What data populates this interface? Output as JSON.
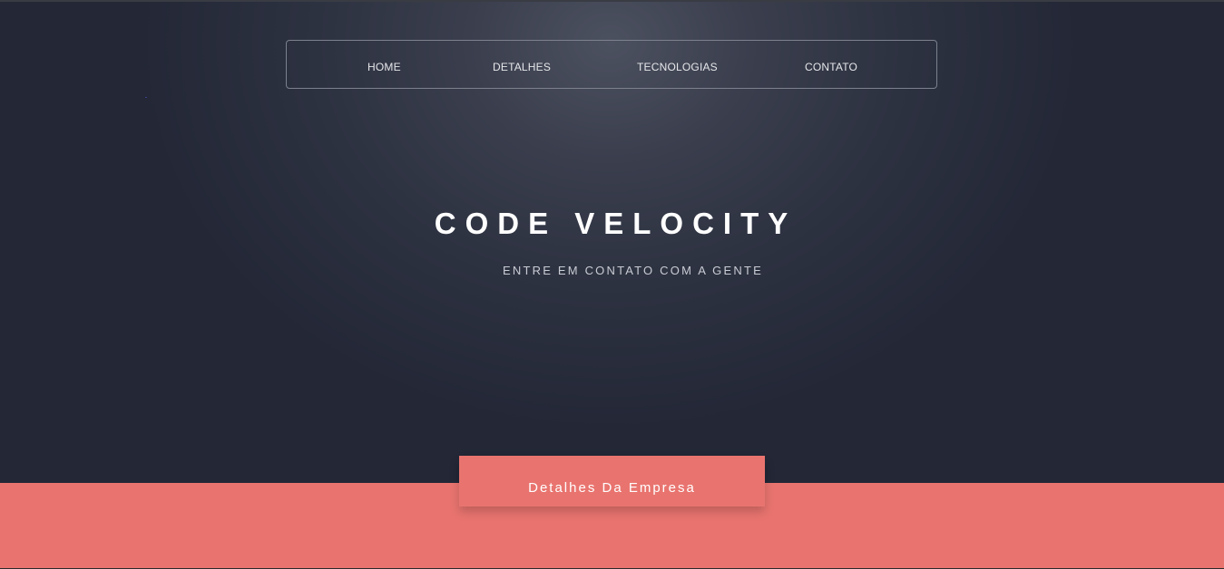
{
  "nav": {
    "items": [
      {
        "label": "HOME"
      },
      {
        "label": "DETALHES"
      },
      {
        "label": "TECNOLOGIAS"
      },
      {
        "label": "CONTATO"
      }
    ]
  },
  "hero": {
    "title": "CODE VELOCITY",
    "subtitle": "ENTRE EM CONTATO COM A GENTE"
  },
  "section": {
    "tab_label": "Detalhes Da Empresa"
  },
  "colors": {
    "hero_background": "#232736",
    "accent": "#e9746f",
    "nav_border": "#7d818e",
    "text": "#ffffff"
  }
}
